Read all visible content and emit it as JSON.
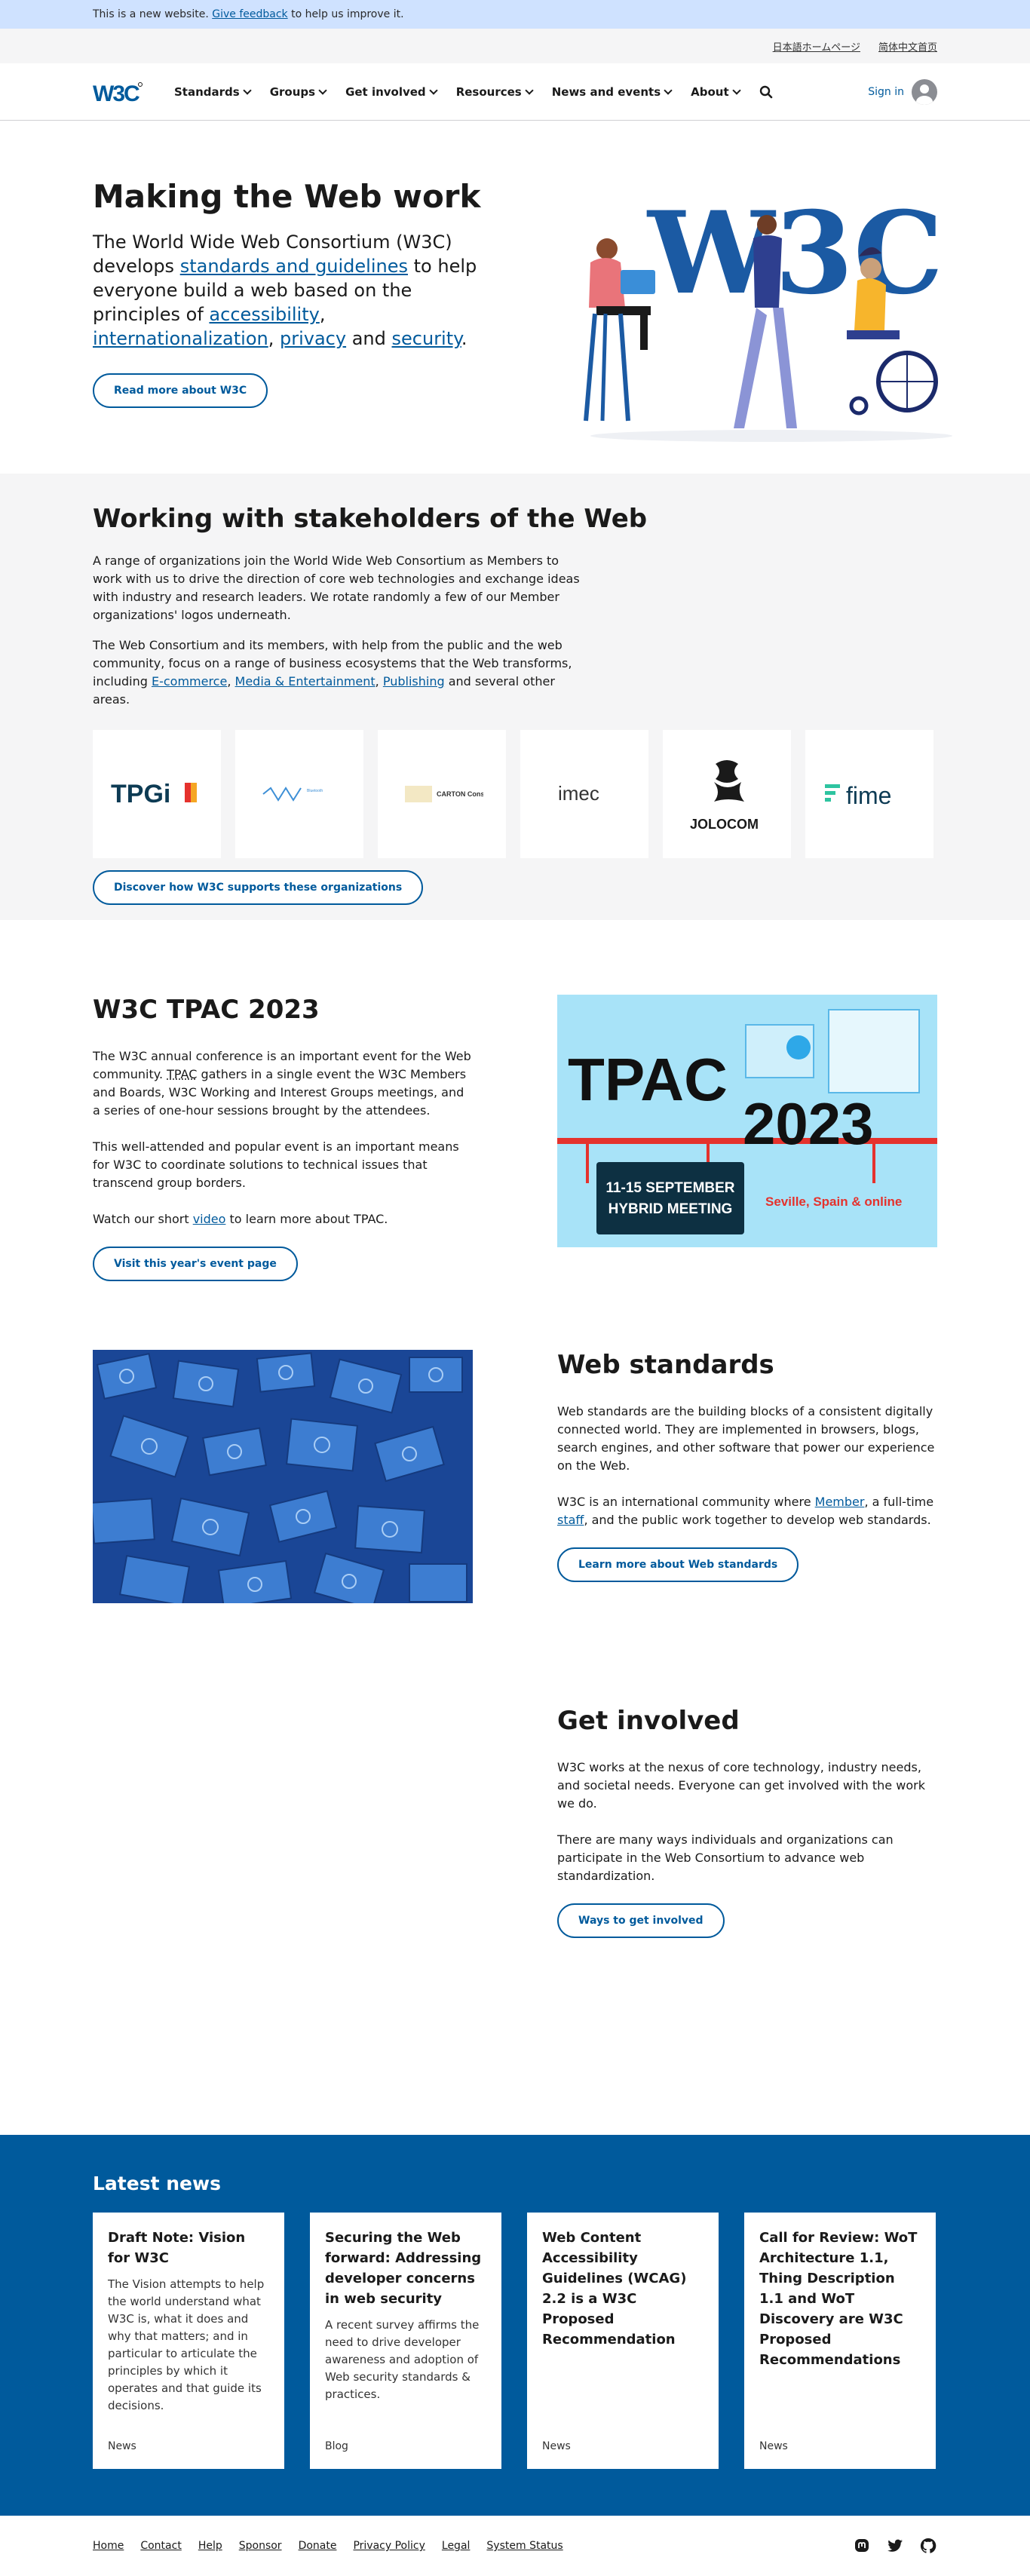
{
  "banner": {
    "prefix": "This is a new website.",
    "link": "Give feedback",
    "suffix": "to help us improve it."
  },
  "lang": {
    "ja": "日本語ホームページ",
    "zh": "简体中文首页"
  },
  "header": {
    "logo": "W3C",
    "nav": [
      "Standards",
      "Groups",
      "Get involved",
      "Resources",
      "News and events",
      "About"
    ],
    "signin": "Sign in"
  },
  "hero": {
    "title": "Making the Web work",
    "t1": "The World Wide Web Consortium (W3C) develops",
    "l1": "standards and guidelines",
    "t2": "to help everyone build a web based on the principles of",
    "l2": "accessibility",
    "t3": ",",
    "l3": "internationalization",
    "t4": ",",
    "l4": "privacy",
    "t5": "and",
    "l5": "security",
    "t6": ".",
    "button": "Read more about W3C",
    "illustration_text": "W3C"
  },
  "stakeholders": {
    "title": "Working with stakeholders of the Web",
    "p1": "A range of organizations join the World Wide Web Consortium as Members to work with us to drive the direction of core web technologies and exchange ideas with industry and research leaders. We rotate randomly a few of our Member organizations' logos underneath.",
    "p2a": "The Web Consortium and its members, with help from the public and the web community, focus on a range of business ecosystems that the Web transforms, including",
    "l1": "E-commerce",
    "c1": ",",
    "l2": "Media & Entertainment",
    "c2": ",",
    "l3": "Publishing",
    "p2b": "and several other areas.",
    "logos": [
      "TPGi",
      "Bluetooth",
      "CARTON Consulting",
      "imec",
      "JOLOCOM",
      "fime"
    ],
    "button": "Discover how W3C supports these organizations"
  },
  "tpac": {
    "title": "W3C TPAC 2023",
    "p1a": "The W3C annual conference is an important event for the Web community.",
    "abbr": "TPAC",
    "p1b": "gathers in a single event the W3C Members and Boards, W3C Working and Interest Groups meetings, and a series of one-hour sessions brought by the attendees.",
    "p2": "This well-attended and popular event is an important means for W3C to coordinate solutions to technical issues that transcend group borders.",
    "p3a": "Watch our short",
    "p3l": "video",
    "p3b": "to learn more about TPAC.",
    "button": "Visit this year's event page",
    "img_word": "TPAC",
    "img_year": "2023",
    "img_dates": "11-15 SEPTEMBER",
    "img_format": "HYBRID MEETING",
    "img_place": "Seville, Spain & online"
  },
  "standards": {
    "title": "Web standards",
    "p1": "Web standards are the building blocks of a consistent digitally connected world. They are implemented in browsers, blogs, search engines, and other software that power our experience on the Web.",
    "p2a": "W3C is an international community where",
    "l1": "Member",
    "p2b": ", a full-time",
    "l2": "staff",
    "p2c": ", and the public work together to develop web standards.",
    "button": "Learn more about Web standards"
  },
  "involved": {
    "title": "Get involved",
    "p1": "W3C works at the nexus of core technology, industry needs, and societal needs. Everyone can get involved with the work we do.",
    "p2": "There are many ways individuals and organizations can participate in the Web Consortium to advance web standardization.",
    "button": "Ways to get involved"
  },
  "news": {
    "title": "Latest news",
    "items": [
      {
        "title": "Draft Note: Vision for W3C",
        "body": "The Vision attempts to help the world understand what W3C is, what it does and why that matters; and in particular to articulate the principles by which it operates and that guide its decisions.",
        "cat": "News"
      },
      {
        "title": "Securing the Web forward: Addressing developer concerns in web security",
        "body": "A recent survey affirms the need to drive developer awareness and adoption of Web security standards & practices.",
        "cat": "Blog"
      },
      {
        "title": "Web Content Accessibility Guidelines (WCAG) 2.2 is a W3C Proposed Recommendation",
        "body": "",
        "cat": "News"
      },
      {
        "title": "Call for Review: WoT Architecture 1.1, Thing Description 1.1 and WoT Discovery are W3C Proposed Recommendations",
        "body": "",
        "cat": "News"
      }
    ]
  },
  "footer": {
    "links": [
      "Home",
      "Contact",
      "Help",
      "Sponsor",
      "Donate",
      "Privacy Policy",
      "Legal",
      "System Status"
    ],
    "social": [
      "mastodon-icon",
      "twitter-icon",
      "github-icon"
    ]
  }
}
